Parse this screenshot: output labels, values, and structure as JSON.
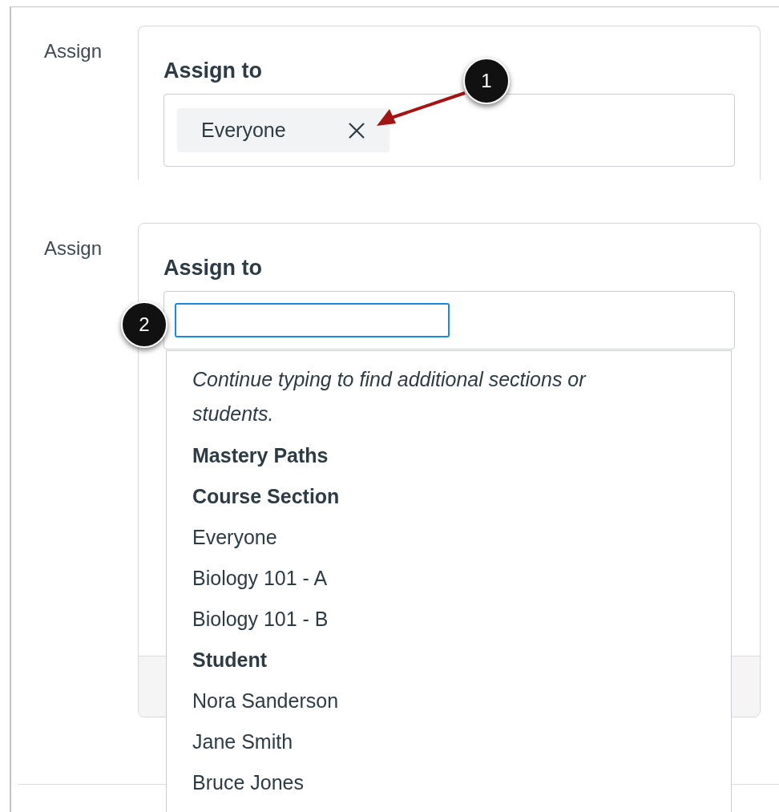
{
  "top_section": {
    "label": "Assign",
    "heading": "Assign to",
    "tokens": [
      {
        "text": "Everyone"
      }
    ],
    "callout": "1"
  },
  "bottom_section": {
    "label": "Assign",
    "heading": "Assign to",
    "search": {
      "focused": true
    },
    "callout": "2",
    "dropdown": {
      "hint": "Continue typing to find additional sections or students.",
      "items": [
        {
          "kind": "group",
          "text": "Mastery Paths"
        },
        {
          "kind": "group",
          "text": "Course Section"
        },
        {
          "kind": "option",
          "text": "Everyone"
        },
        {
          "kind": "option",
          "text": "Biology 101 - A"
        },
        {
          "kind": "option",
          "text": "Biology 101 - B"
        },
        {
          "kind": "group",
          "text": "Student"
        },
        {
          "kind": "option",
          "text": "Nora Sanderson"
        },
        {
          "kind": "option",
          "text": "Jane Smith"
        },
        {
          "kind": "option",
          "text": "Bruce Jones"
        }
      ]
    }
  }
}
